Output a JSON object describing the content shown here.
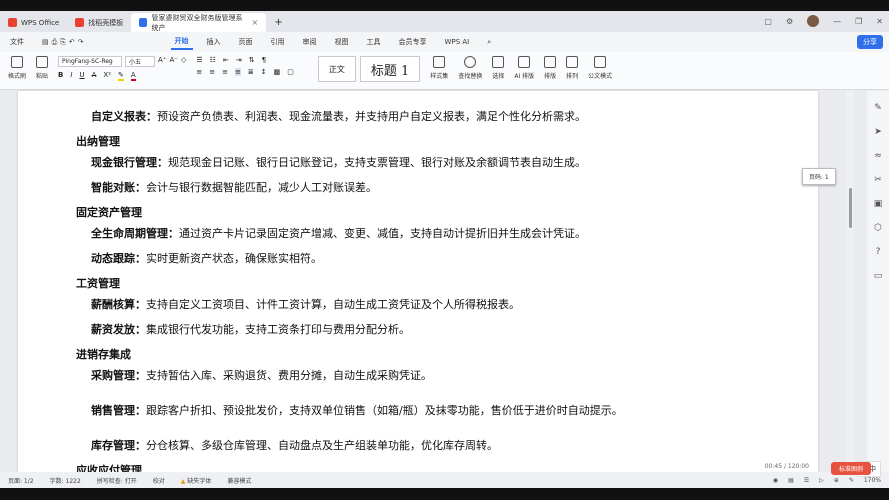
{
  "tabs": [
    {
      "label": "WPS Office"
    },
    {
      "label": "找稻壳模板"
    },
    {
      "label": "管家婆财贸双全财务版管理系统产"
    }
  ],
  "menu": [
    "文件",
    "开始",
    "插入",
    "页面",
    "引用",
    "审阅",
    "视图",
    "工具",
    "会员专享",
    "WPS AI"
  ],
  "share_label": "分享",
  "ribbon": {
    "format_brush": "格式刷",
    "paste": "粘贴",
    "font_name": "PingFang-SC-Reg",
    "font_size": "小五",
    "style_normal": "正文",
    "style_heading": "标题 1",
    "styles_label": "样式集",
    "find_replace": "查找替换",
    "select": "选择",
    "ai_layout": "AI 排版",
    "layout": "排版",
    "arrange": "排列",
    "doc_mode": "公文模式"
  },
  "doc": {
    "l1_b": "自定义报表：",
    "l1": "预设资产负债表、利润表、现金流量表，并支持用户自定义报表，满足个性化分析需求。",
    "h1": "出纳管理",
    "l2_b": "现金银行管理：",
    "l2": "规范现金日记账、银行日记账登记，支持支票管理、银行对账及余额调节表自动生成。",
    "l3_b": "智能对账：",
    "l3": "会计与银行数据智能匹配，减少人工对账误差。",
    "h2": "固定资产管理",
    "l4_b": "全生命周期管理：",
    "l4": "通过资产卡片记录固定资产增减、变更、减值，支持自动计提折旧并生成会计凭证。",
    "l5_b": "动态跟踪：",
    "l5": "实时更新资产状态，确保账实相符。",
    "h3": "工资管理",
    "l6_b": "薪酬核算：",
    "l6": "支持自定义工资项目、计件工资计算，自动生成工资凭证及个人所得税报表。",
    "l7_b": "薪资发放：",
    "l7": "集成银行代发功能，支持工资条打印与费用分配分析。",
    "h4": "进销存集成",
    "l8_b": "采购管理：",
    "l8": "支持暂估入库、采购退货、费用分摊，自动生成采购凭证。",
    "l9_b": "销售管理：",
    "l9": "跟踪客户折扣、预设批发价，支持双单位销售（如箱/瓶）及抹零功能，售价低于进价时自动提示。",
    "l10_b": "库存管理：",
    "l10": "分仓核算、多级仓库管理、自动盘点及生产组装单功能，优化库存周转。",
    "h5": "应收应付管理"
  },
  "tooltip": "页码: 1",
  "status": {
    "page": "页面: 1/2",
    "words": "字数: 1222",
    "spell": "拼写检查: 打开",
    "proof": "校对",
    "missing_font": "缺失字体",
    "compat": "兼容模式",
    "zoom": "170%"
  },
  "ime": "中",
  "overlay_time": "00:45 / 120:00",
  "overlay_btn": "标准图例"
}
